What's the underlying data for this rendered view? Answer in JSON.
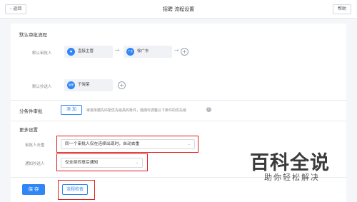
{
  "header": {
    "back_label": "返回",
    "title": "招聘 流程设置",
    "help_label": "帮助"
  },
  "default_flow": {
    "section_title": "默认审批流程",
    "approver_label": "默认审批人",
    "approver_nodes": [
      {
        "avatar_text": "",
        "name": "直接主管"
      },
      {
        "avatar_text": "广东",
        "name": "徐广东"
      }
    ],
    "cc_label": "默认抄送人",
    "cc_nodes": [
      {
        "avatar_text": "晓荣",
        "name": "于晓荣"
      }
    ]
  },
  "conditional": {
    "label": "分条件审批",
    "add_label": "添 加",
    "hint": "审批单据先匹配优先级高的条件，拖拽可调整以下条件的优先级"
  },
  "more_settings": {
    "section_title": "更多设置",
    "dedupe_label": "审批人去重",
    "dedupe_value": "同一个审批人仅在连续出现时，自动去重",
    "notify_label": "通知抄送人",
    "notify_value": "仅全部同意后通知"
  },
  "footer": {
    "save_label": "保 存",
    "check_label": "流程检查"
  },
  "watermark": {
    "main": "百科全说",
    "sub": "助你轻松解决"
  },
  "colors": {
    "accent": "#2f86f6",
    "highlight": "#e02020"
  }
}
